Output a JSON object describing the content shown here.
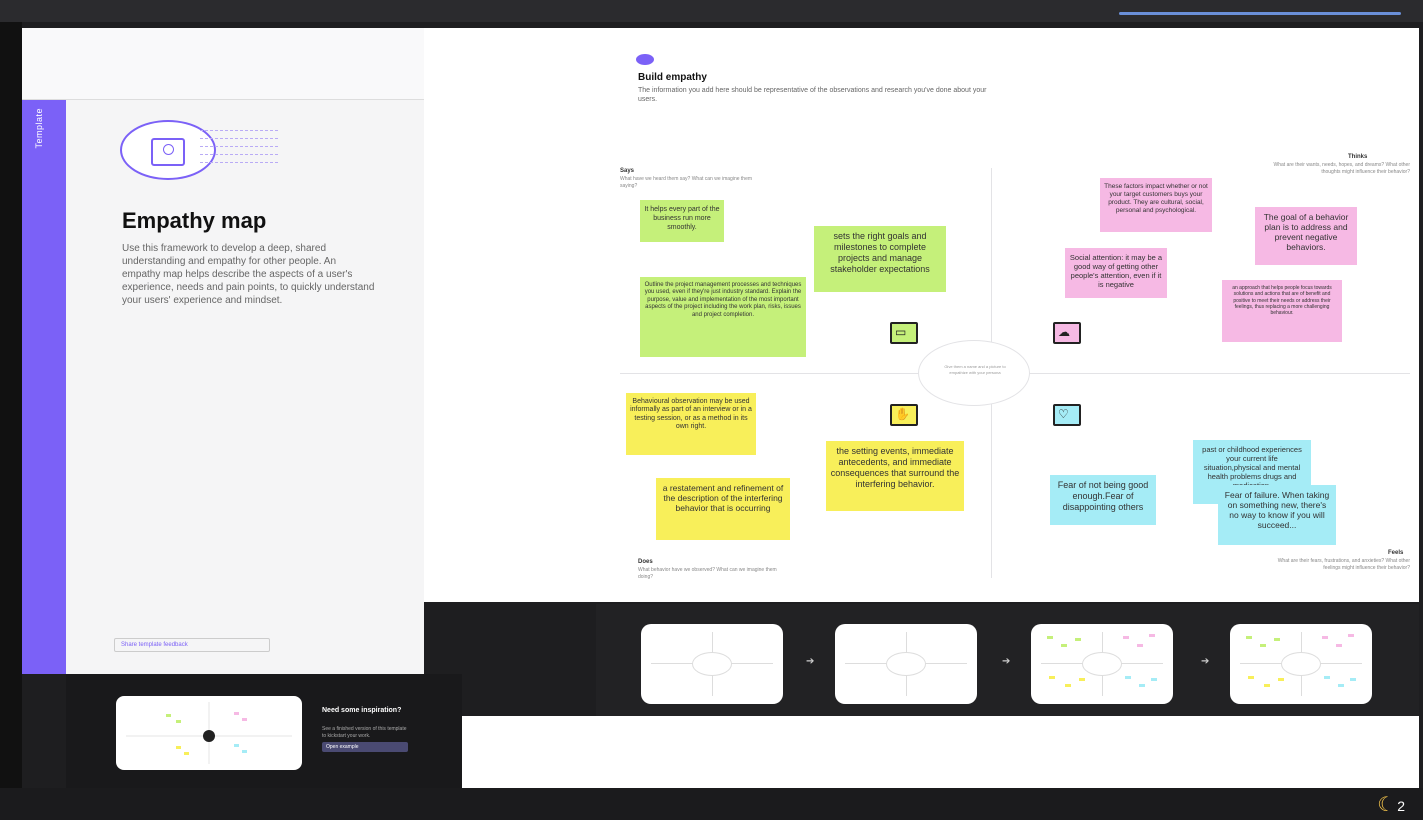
{
  "template_panel": {
    "tag": "Template",
    "title": "Empathy map",
    "description": "Use this framework to develop a deep, shared understanding and empathy for other people. An empathy map helps describe the aspects of a user's experience, needs and pain points, to quickly understand your users' experience and mindset.",
    "feedback_button": "Share template feedback"
  },
  "inspiration": {
    "title": "Need some inspiration?",
    "description": "See a finished version of this template to kickstart your work.",
    "button": "Open example"
  },
  "canvas": {
    "section_title": "Build empathy",
    "section_desc": "The information you add here should be representative of the observations and research you've done about your users.",
    "center_text": "Give them a name and a picture to empathize with your persona",
    "quadrants": {
      "says": {
        "label": "Says",
        "sub": "What have we heard them say? What can we imagine them saying?"
      },
      "thinks": {
        "label": "Thinks",
        "sub": "What are their wants, needs, hopes, and dreams? What other thoughts might influence their behavior?"
      },
      "does": {
        "label": "Does",
        "sub": "What behavior have we observed? What can we imagine them doing?"
      },
      "feels": {
        "label": "Feels",
        "sub": "What are their fears, frustrations, and anxieties? What other feelings might influence their behavior?"
      }
    },
    "notes": {
      "g1": "It helps every part of the business run more smoothly.",
      "g2": "sets the right goals and milestones to complete projects and manage stakeholder expectations",
      "g3": "Outline the project management processes and techniques you used, even if they're just industry standard. Explain the purpose, value and implementation of the most important aspects of the project including the work plan, risks, issues and project completion.",
      "p1": "These factors impact whether or not your target customers buys your product. They are cultural, social, personal and psychological.",
      "p2": "The goal of a behavior plan is to address and prevent negative behaviors.",
      "p3": "Social attention: it may be a good way of getting other people's attention, even if it is negative",
      "p4": "an approach that helps people focus towards solutions and actions that are of benefit and positive to meet their needs or address their feelings, thus replacing a more challenging behaviour.",
      "y1": "Behavioural observation may be used informally as part of an interview or in a testing session, or as a method in its own right.",
      "y2": "the setting events, immediate antecedents, and immediate consequences that surround the interfering behavior.",
      "y3": "a restatement and refinement of the description of the interfering behavior that is occurring",
      "b1": "past or childhood experiences your current life situation,physical and mental health problems drugs and medication.",
      "b2": "Fear of not being good enough.Fear of disappointing others",
      "b3": "Fear of failure. When taking on something new, there's no way to know if you will succeed..."
    }
  },
  "taskbar": {
    "weather_temp": "2"
  },
  "colors": {
    "accent": "#7b61f7",
    "green_note": "#c5f07a",
    "pink_note": "#f6b9e4",
    "yellow_note": "#f8ef5a",
    "blue_note": "#a5ecf6"
  }
}
